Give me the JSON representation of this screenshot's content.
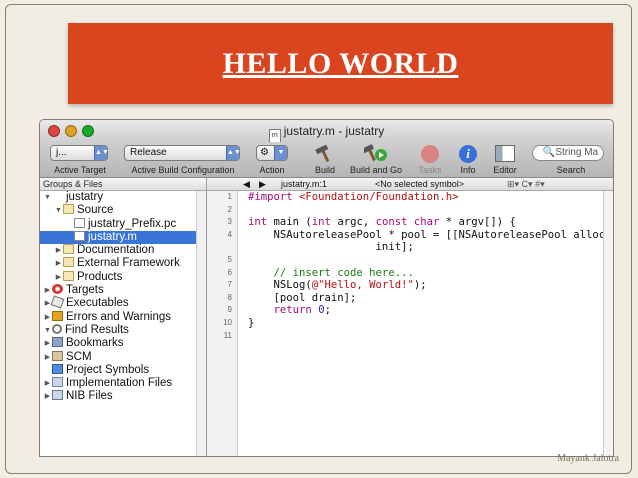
{
  "slide": {
    "title": "HELLO WORLD",
    "author": "Mayank Jalotra",
    "colors": {
      "banner": "#d8451f",
      "background": "#f1ede2"
    }
  },
  "window": {
    "title": "justatry.m - justatry",
    "doc_icon_label": "m"
  },
  "toolbar": {
    "active_target": {
      "value": "j...",
      "label": "Active Target"
    },
    "build_configuration": {
      "value": "Release",
      "label": "Active Build Configuration"
    },
    "action": {
      "label": "Action",
      "icon": "gear-icon"
    },
    "build": {
      "label": "Build",
      "icon": "hammer-icon"
    },
    "build_and_go": {
      "label": "Build and Go",
      "icon": "build-and-go-icon"
    },
    "tasks": {
      "label": "Tasks",
      "icon": "stop-icon"
    },
    "info": {
      "label": "Info",
      "icon": "info-icon",
      "glyph": "i"
    },
    "editor": {
      "label": "Editor",
      "icon": "editor-icon"
    },
    "search": {
      "placeholder": "String Ma",
      "label": "Search"
    }
  },
  "sidebar": {
    "header": "Groups & Files",
    "items": [
      {
        "label": "justatry",
        "tri": "▼",
        "icon": "project",
        "indent": 0
      },
      {
        "label": "Source",
        "tri": "▼",
        "icon": "folder",
        "indent": 1
      },
      {
        "label": "justatry_Prefix.pc",
        "tri": "",
        "icon": "file",
        "indent": 2
      },
      {
        "label": "justatry.m",
        "tri": "",
        "icon": "file",
        "indent": 2,
        "selected": true
      },
      {
        "label": "Documentation",
        "tri": "▶",
        "icon": "folder",
        "indent": 1
      },
      {
        "label": "External Framework",
        "tri": "▶",
        "icon": "folder",
        "indent": 1
      },
      {
        "label": "Products",
        "tri": "▶",
        "icon": "folder",
        "indent": 1
      },
      {
        "label": "Targets",
        "tri": "▶",
        "icon": "target",
        "indent": 0
      },
      {
        "label": "Executables",
        "tri": "▶",
        "icon": "exec",
        "indent": 0
      },
      {
        "label": "Errors and Warnings",
        "tri": "▶",
        "icon": "warn",
        "indent": 0
      },
      {
        "label": "Find Results",
        "tri": "▼",
        "icon": "search",
        "indent": 0
      },
      {
        "label": "Bookmarks",
        "tri": "▶",
        "icon": "book",
        "indent": 0
      },
      {
        "label": "SCM",
        "tri": "▶",
        "icon": "scm",
        "indent": 0
      },
      {
        "label": "Project Symbols",
        "tri": "",
        "icon": "cube",
        "indent": 0
      },
      {
        "label": "Implementation Files",
        "tri": "▶",
        "icon": "list",
        "indent": 0
      },
      {
        "label": "NIB Files",
        "tri": "▶",
        "icon": "nib",
        "indent": 0
      }
    ]
  },
  "editor": {
    "nav": {
      "back": "◀",
      "forward": "▶",
      "file": "justatry.m:1",
      "symbol": "<No selected symbol>",
      "extras": "⊞▾  C▾  #▾"
    },
    "lines": [
      {
        "n": "1",
        "tokens": [
          {
            "t": "#import ",
            "c": "kw"
          },
          {
            "t": "<Foundation/Foundation.h>",
            "c": "str"
          }
        ]
      },
      {
        "n": "2",
        "tokens": []
      },
      {
        "n": "3",
        "tokens": [
          {
            "t": "int",
            "c": "kw"
          },
          {
            "t": " main ("
          },
          {
            "t": "int",
            "c": "kw"
          },
          {
            "t": " argc, "
          },
          {
            "t": "const char",
            "c": "kw"
          },
          {
            "t": " * argv[]) {"
          }
        ]
      },
      {
        "n": "4",
        "tokens": [
          {
            "t": "    NSAutoreleasePool * pool = [[NSAutoreleasePool alloc]"
          }
        ]
      },
      {
        "n": "",
        "tokens": [
          {
            "t": "                    init];"
          }
        ]
      },
      {
        "n": "5",
        "tokens": []
      },
      {
        "n": "6",
        "tokens": [
          {
            "t": "    // insert code here...",
            "c": "cmt"
          }
        ]
      },
      {
        "n": "7",
        "tokens": [
          {
            "t": "    NSLog("
          },
          {
            "t": "@\"Hello, World!\"",
            "c": "str"
          },
          {
            "t": ");"
          }
        ]
      },
      {
        "n": "8",
        "tokens": [
          {
            "t": "    [pool drain];"
          }
        ]
      },
      {
        "n": "9",
        "tokens": [
          {
            "t": "    "
          },
          {
            "t": "return",
            "c": "kw"
          },
          {
            "t": " "
          },
          {
            "t": "0",
            "c": "num"
          },
          {
            "t": ";"
          }
        ]
      },
      {
        "n": "10",
        "tokens": [
          {
            "t": "}"
          }
        ]
      },
      {
        "n": "11",
        "tokens": []
      }
    ]
  }
}
